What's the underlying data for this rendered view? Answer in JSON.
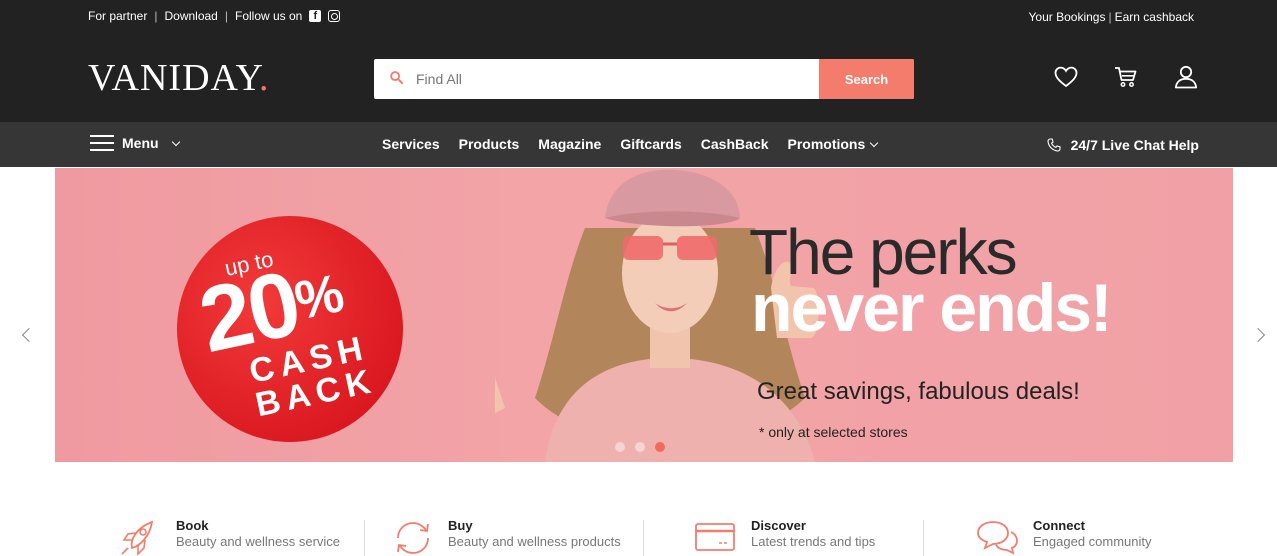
{
  "topbar": {
    "for_partner": "For partner",
    "download": "Download",
    "follow_us": "Follow us on",
    "your_bookings": "Your Bookings",
    "earn_cashback": "Earn cashback"
  },
  "header": {
    "logo": "VANIDAY",
    "logo_dot": ".",
    "search_placeholder": "Find All",
    "search_button": "Search",
    "icons": [
      "heart-icon",
      "cart-icon",
      "user-icon"
    ]
  },
  "nav": {
    "menu_label": "Menu",
    "links": [
      "Services",
      "Products",
      "Magazine",
      "Giftcards",
      "CashBack",
      "Promotions"
    ],
    "live_chat": "24/7 Live Chat Help"
  },
  "hero": {
    "badge_upto": "up to",
    "badge_percent": "20",
    "badge_percent_sign": "%",
    "badge_cash": "CASH",
    "badge_back": "BACK",
    "headline_1": "The perks",
    "headline_2": "never ends!",
    "subline": "Great savings, fabulous deals!",
    "note": "* only at selected stores",
    "slide_count": 3,
    "active_slide": 3
  },
  "features": [
    {
      "title": "Book",
      "subtitle": "Beauty and wellness service",
      "icon": "rocket-icon"
    },
    {
      "title": "Buy",
      "subtitle": "Beauty and wellness products",
      "icon": "refresh-icon"
    },
    {
      "title": "Discover",
      "subtitle": "Latest trends and tips",
      "icon": "card-icon"
    },
    {
      "title": "Connect",
      "subtitle": "Engaged community",
      "icon": "chat-bubbles-icon"
    }
  ],
  "colors": {
    "accent": "#f47c6c",
    "dark": "#222222",
    "nav": "#363636",
    "hero_bg": "#f1a1a5",
    "badge_red": "#d8161e"
  }
}
